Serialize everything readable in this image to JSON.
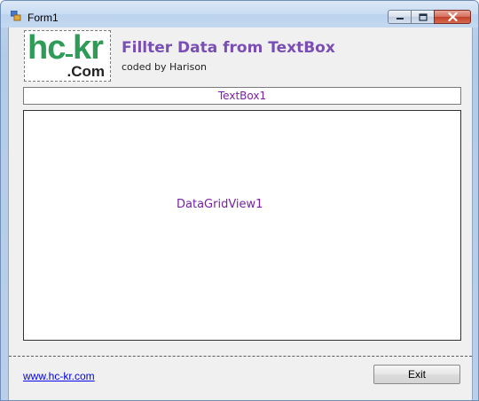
{
  "window": {
    "title": "Form1",
    "icon": "winform-icon",
    "controls": {
      "minimize": "minimize-icon",
      "maximize": "maximize-icon",
      "close": "close-icon"
    }
  },
  "logo": {
    "main": "hc",
    "main2": "kr",
    "suffix": ".Com"
  },
  "header": {
    "title": "Fillter Data from TextBox",
    "subtitle": "coded by Harison"
  },
  "textbox": {
    "placeholder": "TextBox1"
  },
  "grid": {
    "label": "DataGridView1"
  },
  "footer": {
    "link": "www.hc-kr.com",
    "exit_label": "Exit"
  },
  "colors": {
    "accent": "#7a4fb5",
    "control_text": "#7a1fa8",
    "logo_green": "#2e9b57",
    "link": "#0000ee"
  }
}
